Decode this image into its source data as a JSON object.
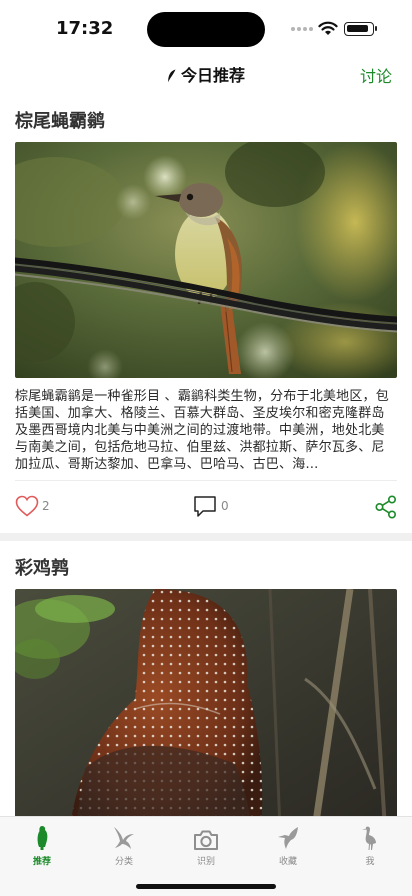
{
  "status": {
    "time": "17:32"
  },
  "nav": {
    "title": "今日推荐",
    "discuss_label": "讨论"
  },
  "posts": [
    {
      "title": "棕尾蝇霸鹟",
      "description": "棕尾蝇霸鹟是一种雀形目 、霸鹟科类生物，分布于北美地区，包括美国、加拿大、格陵兰、百慕大群岛、圣皮埃尔和密克隆群岛及墨西哥境内北美与中美洲之间的过渡地带。中美洲，地处北美与南美之间，包括危地马拉、伯里兹、洪都拉斯、萨尔瓦多、尼加拉瓜、哥斯达黎加、巴拿马、巴哈马、古巴、海…",
      "likes": "2",
      "comments": "0"
    },
    {
      "title": "彩鸡鹑"
    }
  ],
  "tabs": [
    {
      "label": "推荐",
      "icon": "bird-standing-icon",
      "active": true
    },
    {
      "label": "分类",
      "icon": "bird-flying-icon"
    },
    {
      "label": "识别",
      "icon": "camera-icon"
    },
    {
      "label": "收藏",
      "icon": "hummingbird-icon"
    },
    {
      "label": "我",
      "icon": "heron-icon"
    }
  ],
  "colors": {
    "accent": "#1c8a2a",
    "like": "#e05a5a",
    "share": "#1c8a2a"
  }
}
